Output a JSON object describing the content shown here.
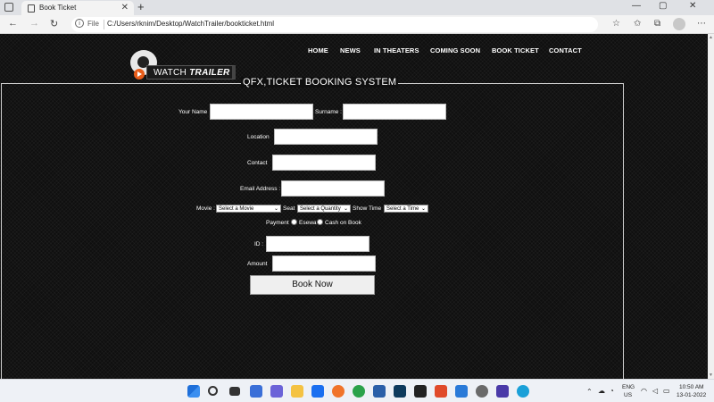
{
  "browser": {
    "tab_title": "Book Ticket",
    "tab_close": "✕",
    "new_tab": "+",
    "scheme_label": "File",
    "url": "C:/Users/rknim/Desktop/WatchTrailer/bookticket.html",
    "window_controls": [
      "—",
      "▢",
      "✕"
    ]
  },
  "site": {
    "menu": [
      "HOME",
      "NEWS",
      "IN THEATERS",
      "COMING SOON",
      "BOOK TICKET",
      "CONTACT"
    ],
    "logo_word1": "WATCH ",
    "logo_word2": "TRAILER"
  },
  "form": {
    "legend": "QFX,TICKET BOOKING SYSTEM",
    "your_name_label": "Your Name",
    "surname_label": "Surname :",
    "location_label": "Location",
    "contact_label": "Contact",
    "email_label": "Email Address :",
    "movie_label": "Movie :",
    "movie_select": "Select a Movie",
    "seat_label": "Seat",
    "seat_select": "Select a Quantity",
    "showtime_label": "Show Time",
    "showtime_select": "Select a Time",
    "payment_label": "Payment",
    "payment_options": [
      "Esewa",
      "Cash on Book"
    ],
    "id_label": "ID :",
    "amount_label": "Amount",
    "submit_label": "Book Now"
  },
  "taskbar": {
    "language": "ENG",
    "region": "US",
    "time": "10:50 AM",
    "date": "13-01-2022"
  },
  "colors": {
    "page_background": "#0f0f0f",
    "logo_accent": "#e85d1a",
    "text": "#ffffff"
  }
}
